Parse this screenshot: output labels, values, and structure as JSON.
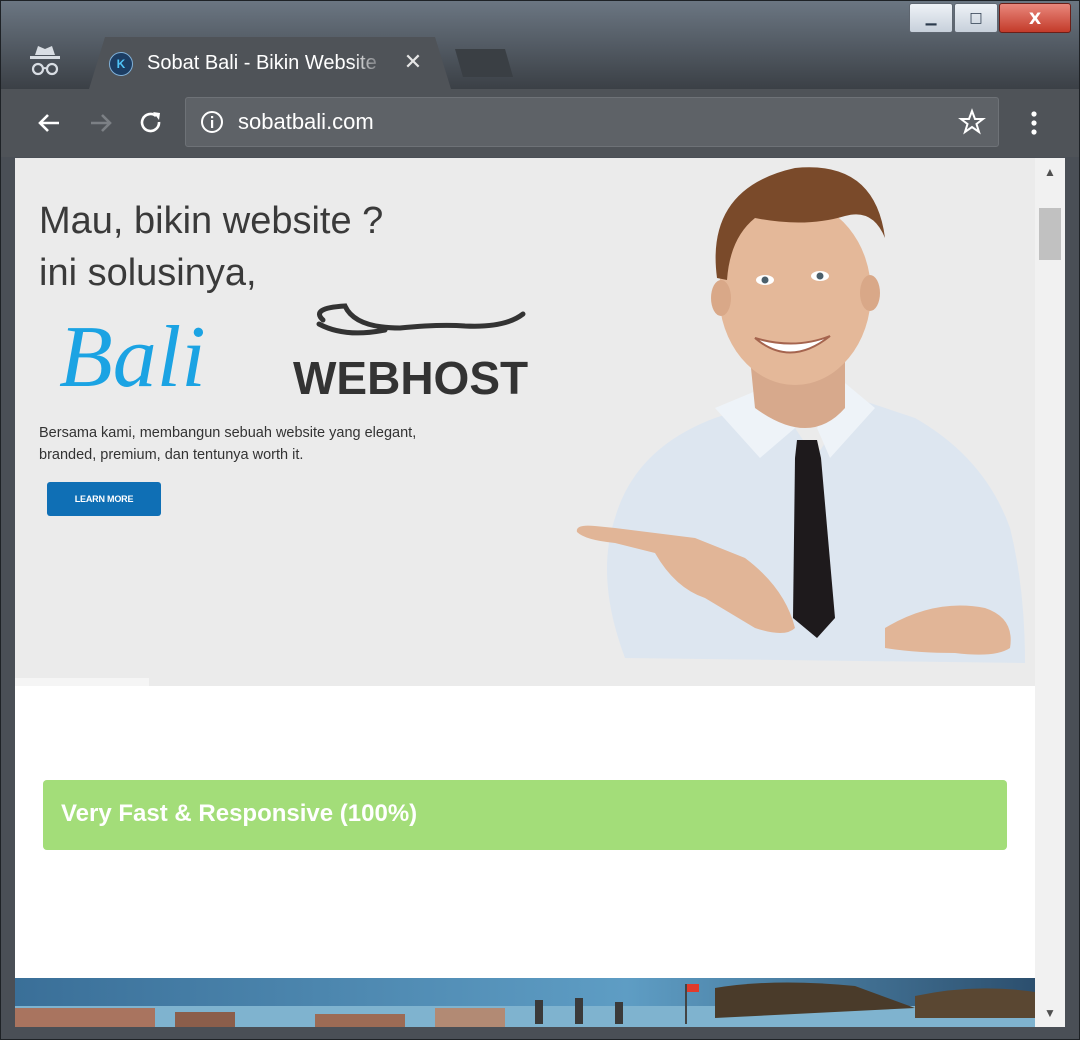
{
  "window": {
    "minimize_label": "▁",
    "maximize_label": "□",
    "close_label": "X"
  },
  "tab": {
    "favicon": "K",
    "title": "Sobat Bali - Bikin Website",
    "close_label": "✕"
  },
  "toolbar": {
    "url": "sobatbali.com",
    "icons": [
      "back-icon",
      "forward-icon",
      "reload-icon",
      "info-icon",
      "star-icon",
      "menu-icon"
    ]
  },
  "hero": {
    "heading_line1": "Mau, bikin website ?",
    "heading_line2": "ini solusinya,",
    "logo_script": "Bali",
    "logo_word": "WEBHOST",
    "tagline_line1": "Bersama kami, membangun sebuah website yang elegant,",
    "tagline_line2": "branded, premium, dan tentunya worth it.",
    "button_label": "LEARN MORE"
  },
  "skills": {
    "label": "Very Fast & Responsive (100%)",
    "percent": 100,
    "color": "#a3dd79"
  },
  "colors": {
    "brand_blue": "#1ba3e3",
    "button_blue": "#0f6fb5",
    "progress_green": "#a3dd79"
  }
}
